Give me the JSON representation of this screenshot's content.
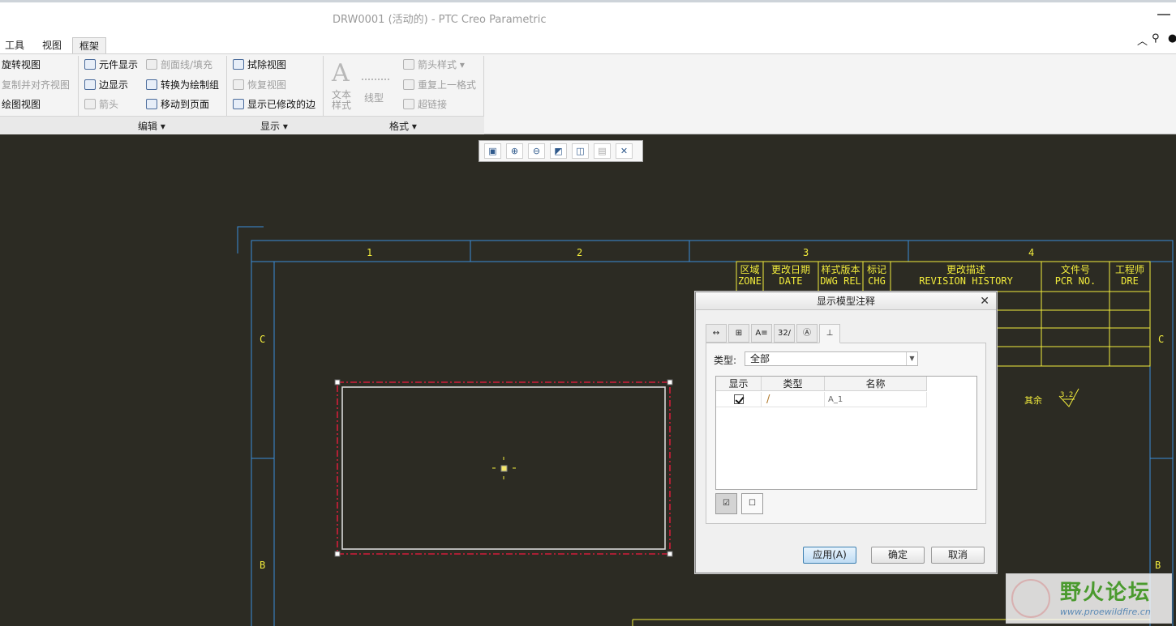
{
  "window": {
    "title": "DRW0001 (活动的) - PTC Creo Parametric"
  },
  "tabs": [
    {
      "label": "工具",
      "selected": false
    },
    {
      "label": "视图",
      "selected": false
    },
    {
      "label": "框架",
      "selected": false
    }
  ],
  "ribbon": {
    "col1": [
      "旋转视图",
      "复制并对齐视图",
      "绘图视图"
    ],
    "col2": [
      "元件显示",
      "边显示",
      "箭头"
    ],
    "col3": [
      "剖面线/填充",
      "转换为绘制组",
      "移动到页面"
    ],
    "col4": [
      "拭除视图",
      "恢复视图",
      "显示已修改的边"
    ],
    "text_style": "文本\n样式",
    "line_style": "线型",
    "col6": [
      "箭头样式",
      "重复上一格式",
      "超链接"
    ],
    "groups": {
      "edit": "编辑",
      "display": "显示",
      "format": "格式"
    }
  },
  "drawing": {
    "zones": [
      "1",
      "2",
      "3",
      "4"
    ],
    "rows": [
      "C",
      "C",
      "B",
      "B"
    ],
    "revision_table": {
      "headers": [
        [
          "区域",
          "ZONE"
        ],
        [
          "更改日期",
          "DATE"
        ],
        [
          "样式版本",
          "DWG REL"
        ],
        [
          "标记",
          "CHG"
        ],
        [
          "更改描述",
          "REVISION HISTORY"
        ],
        [
          "文件号",
          "PCR NO."
        ],
        [
          "工程师",
          "DRE"
        ]
      ]
    },
    "surface_note": "其余",
    "roughness_value": "3.2"
  },
  "dialog": {
    "title": "显示模型注释",
    "tabs": [
      "↔",
      "⊞",
      "A≡",
      "32/",
      "Ⓐ",
      "⊥"
    ],
    "type_label": "类型:",
    "type_value": "全部",
    "columns": [
      "显示",
      "类型",
      "名称"
    ],
    "rows": [
      {
        "shown": true,
        "type": "/",
        "name": "A_1"
      }
    ],
    "buttons": {
      "apply": "应用(A)",
      "ok": "确定",
      "cancel": "取消"
    }
  },
  "watermark": {
    "name": "野火论坛",
    "url": "www.proewildfire.cn"
  }
}
